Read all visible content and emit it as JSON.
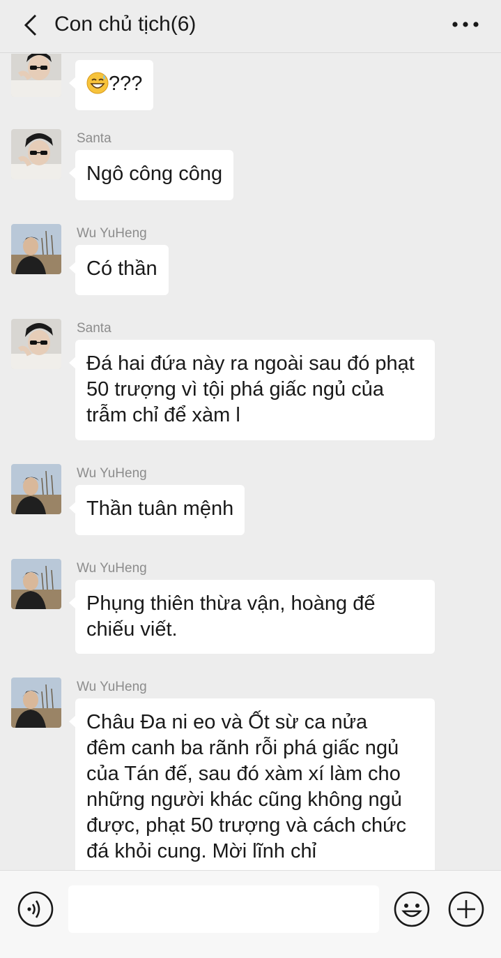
{
  "header": {
    "title": "Con chủ tịch(6)"
  },
  "messages": [
    {
      "sender": "",
      "avatar": "santa",
      "lines": [
        "???"
      ],
      "emoji_prefix": "grinning-sweat-emoji"
    },
    {
      "sender": "Santa",
      "avatar": "santa",
      "lines": [
        "Ngô công công"
      ]
    },
    {
      "sender": "Wu YuHeng",
      "avatar": "wuyuheng",
      "lines": [
        "Có thần"
      ]
    },
    {
      "sender": "Santa",
      "avatar": "santa",
      "lines": [
        "Đá hai đứa này ra ngoài sau đó phạt",
        "50 trượng vì tội phá giấc ngủ của",
        "trẫm chỉ để xàm l"
      ]
    },
    {
      "sender": "Wu YuHeng",
      "avatar": "wuyuheng",
      "lines": [
        "Thần tuân mệnh"
      ]
    },
    {
      "sender": "Wu YuHeng",
      "avatar": "wuyuheng",
      "lines": [
        "Phụng thiên thừa vận, hoàng đế",
        "chiếu viết."
      ]
    },
    {
      "sender": "Wu YuHeng",
      "avatar": "wuyuheng",
      "lines": [
        "Châu Đa ni eo và Ốt sừ ca nửa",
        "đêm canh ba rãnh rỗi phá giấc ngủ",
        "của Tán đế, sau đó xàm xí làm cho",
        "những người khác cũng không ngủ",
        "được, phạt 50 trượng và cách chức",
        "đá khỏi cung. Mời lĩnh chỉ"
      ]
    }
  ],
  "footer": {
    "input_placeholder": "",
    "voice_icon": "voice-icon",
    "emoji_icon": "emoji-icon",
    "plus_icon": "plus-icon"
  },
  "colors": {
    "background": "#ededed",
    "bubble": "#ffffff",
    "sender_text": "#8c8c8c",
    "footer": "#f7f7f7"
  }
}
